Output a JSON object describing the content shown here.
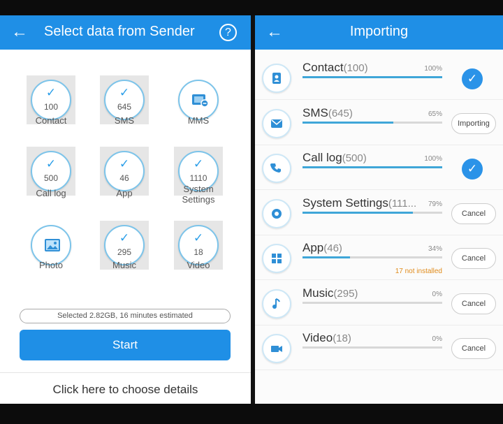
{
  "left": {
    "title": "Select data from Sender",
    "help": "?",
    "items": [
      {
        "label": "Contact",
        "count": "100",
        "selected": true
      },
      {
        "label": "SMS",
        "count": "645",
        "selected": true
      },
      {
        "label": "MMS",
        "count": "",
        "selected": false,
        "icon": "mms-icon"
      },
      {
        "label": "Call log",
        "count": "500",
        "selected": true
      },
      {
        "label": "App",
        "count": "46",
        "selected": true
      },
      {
        "label": "System Settings",
        "count": "1110",
        "selected": true
      },
      {
        "label": "Photo",
        "count": "",
        "selected": false,
        "icon": "photo-icon"
      },
      {
        "label": "Music",
        "count": "295",
        "selected": true
      },
      {
        "label": "Video",
        "count": "18",
        "selected": true
      }
    ],
    "summary": "Selected 2.82GB, 16 minutes estimated",
    "start_label": "Start",
    "details_link": "Click here to choose details"
  },
  "right": {
    "title": "Importing",
    "rows": [
      {
        "name": "Contact",
        "count": "(100)",
        "percent": "100%",
        "progress": 1.0,
        "status": "done",
        "icon": "contact-icon"
      },
      {
        "name": "SMS",
        "count": "(645)",
        "percent": "65%",
        "progress": 0.65,
        "status": "Importing",
        "icon": "sms-icon"
      },
      {
        "name": "Call log",
        "count": "(500)",
        "percent": "100%",
        "progress": 1.0,
        "status": "done",
        "icon": "phone-icon"
      },
      {
        "name": "System Settings",
        "count": "(111...",
        "percent": "79%",
        "progress": 0.79,
        "status": "Cancel",
        "icon": "gear-icon"
      },
      {
        "name": "App",
        "count": "(46)",
        "percent": "34%",
        "progress": 0.34,
        "status": "Cancel",
        "icon": "apps-icon",
        "note": "17 not installed"
      },
      {
        "name": "Music",
        "count": "(295)",
        "percent": "0%",
        "progress": 0,
        "status": "Cancel",
        "icon": "music-icon"
      },
      {
        "name": "Video",
        "count": "(18)",
        "percent": "0%",
        "progress": 0,
        "status": "Cancel",
        "icon": "video-icon"
      }
    ]
  },
  "colors": {
    "accent": "#1f8fe6",
    "progress": "#3fa6d8",
    "warning": "#e08b1b"
  }
}
